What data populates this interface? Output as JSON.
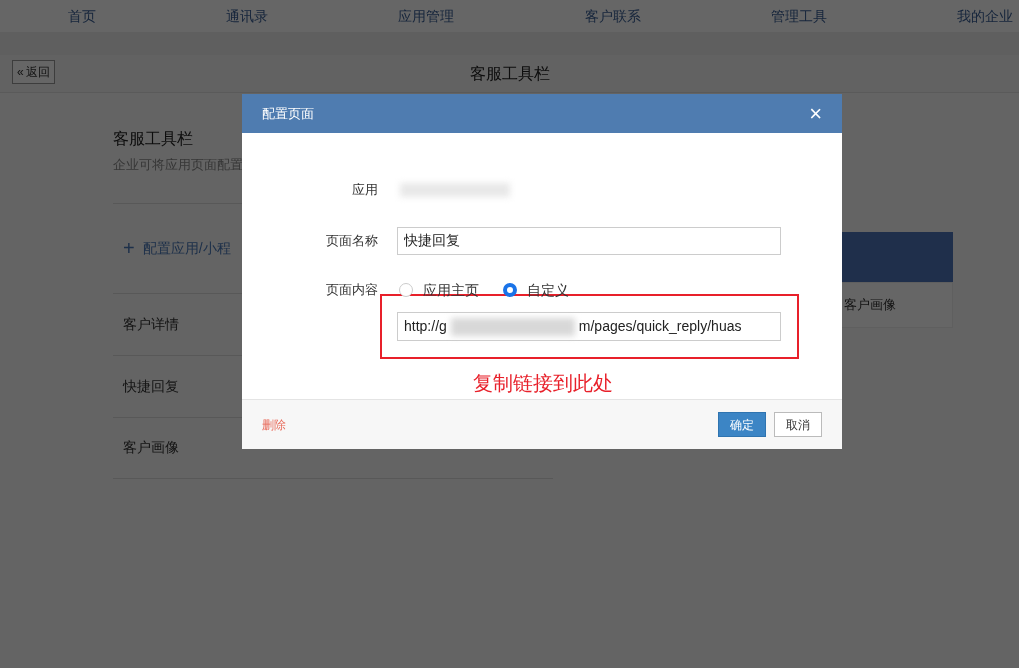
{
  "nav": [
    {
      "label": "首页"
    },
    {
      "label": "通讯录"
    },
    {
      "label": "应用管理"
    },
    {
      "label": "客户联系"
    },
    {
      "label": "管理工具"
    },
    {
      "label": "我的企业"
    }
  ],
  "header": {
    "back_glyph": "«",
    "back": "返回",
    "title": "客服工具栏"
  },
  "section": {
    "title": "客服工具栏",
    "subtitle": "企业可将应用页面配置",
    "add_glyph": "+",
    "add": "配置应用/小程",
    "rows": [
      {
        "label": "客户详情"
      },
      {
        "label": "快捷回复"
      },
      {
        "label": "客户画像"
      }
    ]
  },
  "preview": {
    "tab": "客户画像"
  },
  "dialog": {
    "title": "配置页面",
    "close": "×",
    "app_label": "应用",
    "name_label": "页面名称",
    "name_value": "快捷回复",
    "content_label": "页面内容",
    "content_options": [
      {
        "label": "应用主页",
        "selected": false
      },
      {
        "label": "自定义",
        "selected": true
      }
    ],
    "url_start": "http://g",
    "url_end": "m/pages/quick_reply/huas",
    "annotation": "复制链接到此处",
    "delete": "删除",
    "confirm": "确定",
    "cancel": "取消"
  }
}
